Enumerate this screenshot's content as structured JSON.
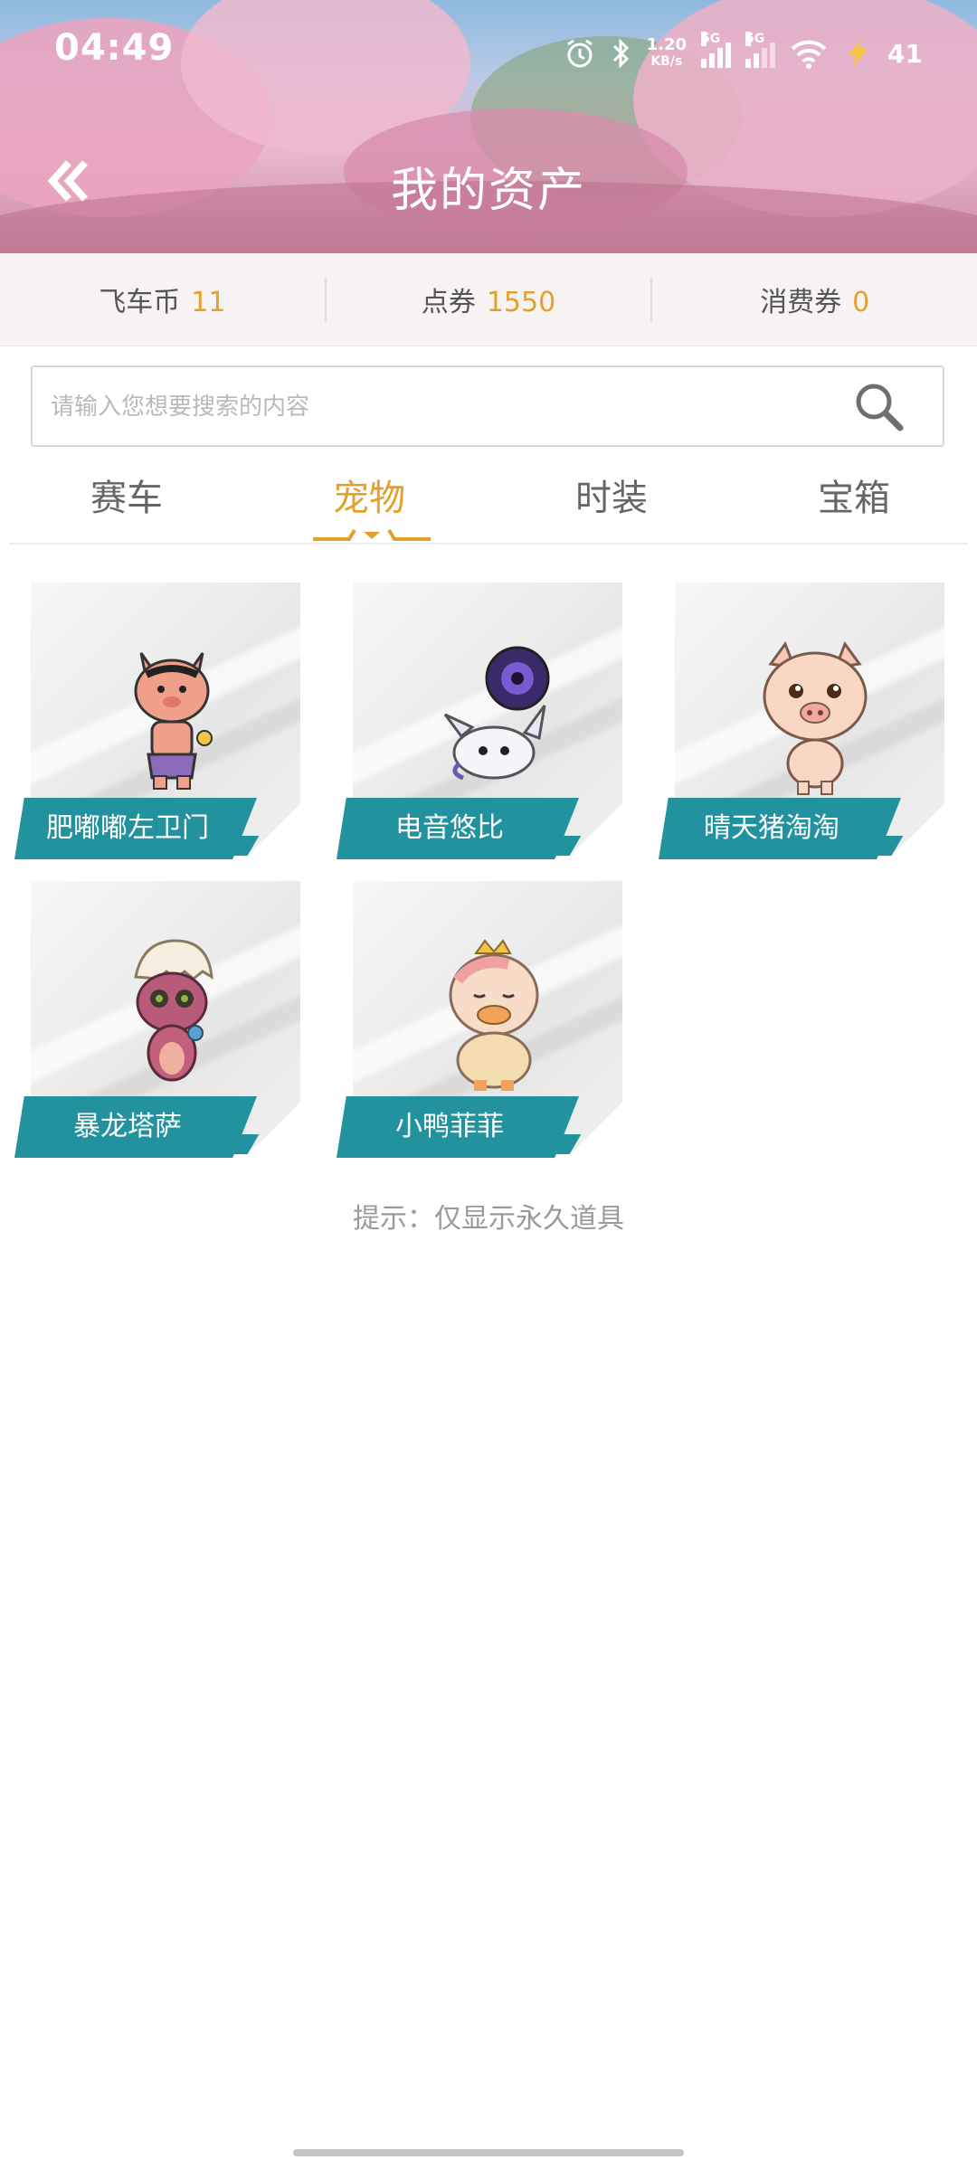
{
  "status_bar": {
    "time": "04:49",
    "net_speed_value": "1.20",
    "net_speed_unit": "KB/s",
    "signal_1_label": "5G",
    "signal_2_label": "5G",
    "battery": "41"
  },
  "header": {
    "title": "我的资产"
  },
  "currency": [
    {
      "label": "飞车币",
      "value": "11"
    },
    {
      "label": "点券",
      "value": "1550"
    },
    {
      "label": "消费券",
      "value": "0"
    }
  ],
  "search": {
    "placeholder": "请输入您想要搜索的内容",
    "value": ""
  },
  "tabs": [
    {
      "label": "赛车",
      "active": false
    },
    {
      "label": "宠物",
      "active": true
    },
    {
      "label": "时装",
      "active": false
    },
    {
      "label": "宝箱",
      "active": false
    }
  ],
  "pets": [
    {
      "name": "肥嘟嘟左卫门",
      "icon": "pink-pig-pet-icon"
    },
    {
      "name": "电音悠比",
      "icon": "headphone-bunny-pet-icon"
    },
    {
      "name": "晴天猪淘淘",
      "icon": "sunny-pig-pet-icon"
    },
    {
      "name": "暴龙塔萨",
      "icon": "baby-dragon-pet-icon"
    },
    {
      "name": "小鸭菲菲",
      "icon": "duckling-pet-icon"
    }
  ],
  "hint": "提示：仅显示永久道具",
  "colors": {
    "accent": "#e3a12c",
    "name_plate": "#23929f"
  }
}
